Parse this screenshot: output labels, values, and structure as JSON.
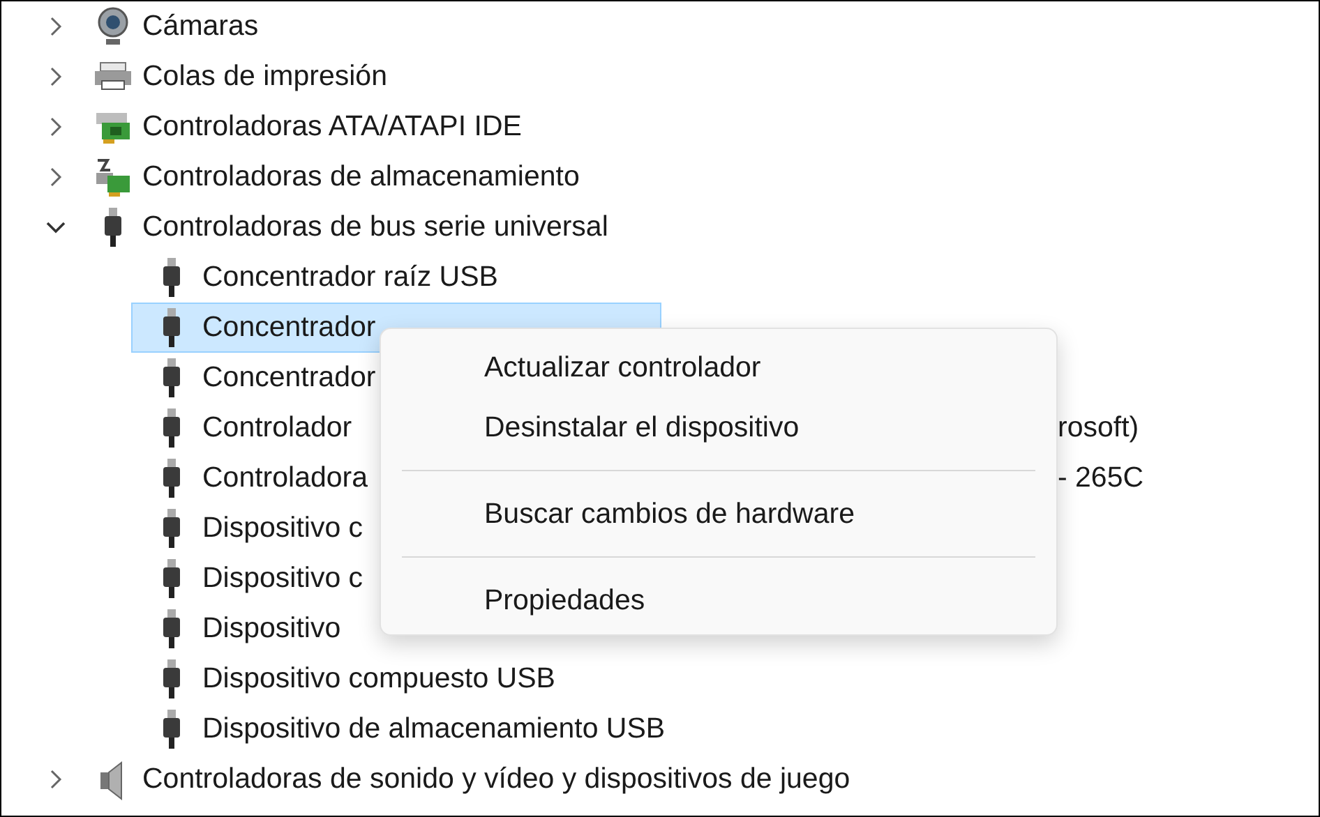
{
  "tree": [
    {
      "label": "Cámaras",
      "expanded": false
    },
    {
      "label": "Colas de impresión",
      "expanded": false
    },
    {
      "label": "Controladoras ATA/ATAPI IDE",
      "expanded": false
    },
    {
      "label": "Controladoras de almacenamiento",
      "expanded": false
    },
    {
      "label": "Controladoras de bus serie universal",
      "expanded": true,
      "children": [
        {
          "label": "Concentrador raíz USB",
          "selected": false
        },
        {
          "label": "Concentrador",
          "selected": true
        },
        {
          "label": "Concentrador",
          "selected": false
        },
        {
          "label": "Controlador",
          "tail": "rosoft)",
          "selected": false
        },
        {
          "label": "Controladora",
          "tail": "- 265C",
          "selected": false
        },
        {
          "label": "Dispositivo c",
          "selected": false
        },
        {
          "label": "Dispositivo c",
          "selected": false
        },
        {
          "label": "Dispositivo",
          "selected": false
        },
        {
          "label": "Dispositivo compuesto USB",
          "selected": false
        },
        {
          "label": "Dispositivo de almacenamiento USB",
          "selected": false
        }
      ]
    },
    {
      "label": "Controladoras de sonido y vídeo y dispositivos de juego",
      "expanded": false
    }
  ],
  "context_menu": {
    "groups": [
      [
        "Actualizar controlador",
        "Desinstalar el dispositivo"
      ],
      [
        "Buscar cambios de hardware"
      ],
      [
        "Propiedades"
      ]
    ]
  }
}
